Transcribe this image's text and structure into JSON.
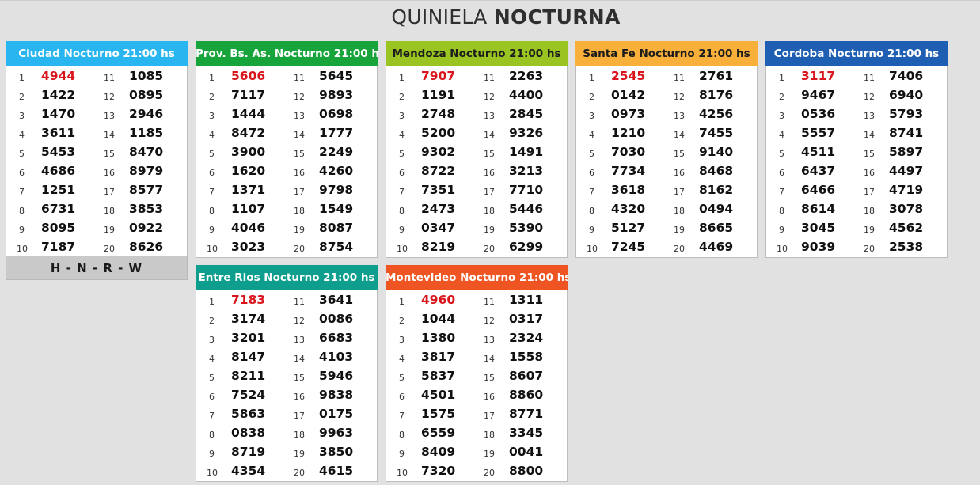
{
  "page": {
    "title_light": "QUINIELA",
    "title_bold": "NOCTURNA"
  },
  "footer": {
    "letters": "H - N - R - W"
  },
  "colors": {
    "ciudad": "#29b6f0",
    "provincia": "#17a43a",
    "mendoza": "#9ac421",
    "santafe": "#f8b03a",
    "cordoba": "#1e5fb3",
    "entrerios": "#0e9e8e",
    "montevideo": "#ee5522",
    "first_number": "#d9161e"
  },
  "cards": [
    {
      "id": "ciudad",
      "title": "Ciudad Nocturno 21:00 hs",
      "color": "#29b6f0",
      "dark_text": false,
      "numbers": [
        "4944",
        "1422",
        "1470",
        "3611",
        "5453",
        "4686",
        "1251",
        "6731",
        "8095",
        "7187",
        "1085",
        "0895",
        "2946",
        "1185",
        "8470",
        "8979",
        "8577",
        "3853",
        "0922",
        "8626"
      ]
    },
    {
      "id": "provincia",
      "title": "Prov. Bs. As. Nocturno 21:00 hs",
      "color": "#17a43a",
      "dark_text": false,
      "numbers": [
        "5606",
        "7117",
        "1444",
        "8472",
        "3900",
        "1620",
        "1371",
        "1107",
        "4046",
        "3023",
        "5645",
        "9893",
        "0698",
        "1777",
        "2249",
        "4260",
        "9798",
        "1549",
        "8087",
        "8754"
      ]
    },
    {
      "id": "mendoza",
      "title": "Mendoza Nocturno 21:00 hs",
      "color": "#9ac421",
      "dark_text": true,
      "numbers": [
        "7907",
        "1191",
        "2748",
        "5200",
        "9302",
        "8722",
        "7351",
        "2473",
        "0347",
        "8219",
        "2263",
        "4400",
        "2845",
        "9326",
        "1491",
        "3213",
        "7710",
        "5446",
        "5390",
        "6299"
      ]
    },
    {
      "id": "santafe",
      "title": "Santa Fe Nocturno 21:00 hs",
      "color": "#f8b03a",
      "dark_text": true,
      "numbers": [
        "2545",
        "0142",
        "0973",
        "1210",
        "7030",
        "7734",
        "3618",
        "4320",
        "5127",
        "7245",
        "2761",
        "8176",
        "4256",
        "7455",
        "9140",
        "8468",
        "8162",
        "0494",
        "8665",
        "4469"
      ]
    },
    {
      "id": "cordoba",
      "title": "Cordoba Nocturno 21:00 hs",
      "color": "#1e5fb3",
      "dark_text": false,
      "numbers": [
        "3117",
        "9467",
        "0536",
        "5557",
        "4511",
        "6437",
        "6466",
        "8614",
        "3045",
        "9039",
        "7406",
        "6940",
        "5793",
        "8741",
        "5897",
        "4497",
        "4719",
        "3078",
        "4562",
        "2538"
      ]
    },
    {
      "id": "entrerios",
      "title": "Entre Rios Nocturno 21:00 hs",
      "color": "#0e9e8e",
      "dark_text": false,
      "numbers": [
        "7183",
        "3174",
        "3201",
        "8147",
        "8211",
        "7524",
        "5863",
        "0838",
        "8719",
        "4354",
        "3641",
        "0086",
        "6683",
        "4103",
        "5946",
        "9838",
        "0175",
        "9963",
        "3850",
        "4615"
      ]
    },
    {
      "id": "montevideo",
      "title": "Montevideo Nocturno 21:00 hs",
      "color": "#ee5522",
      "dark_text": false,
      "numbers": [
        "4960",
        "1044",
        "1380",
        "3817",
        "5837",
        "4501",
        "1575",
        "6559",
        "8409",
        "7320",
        "1311",
        "0317",
        "2324",
        "1558",
        "8607",
        "8860",
        "8771",
        "3345",
        "0041",
        "8800"
      ]
    }
  ]
}
